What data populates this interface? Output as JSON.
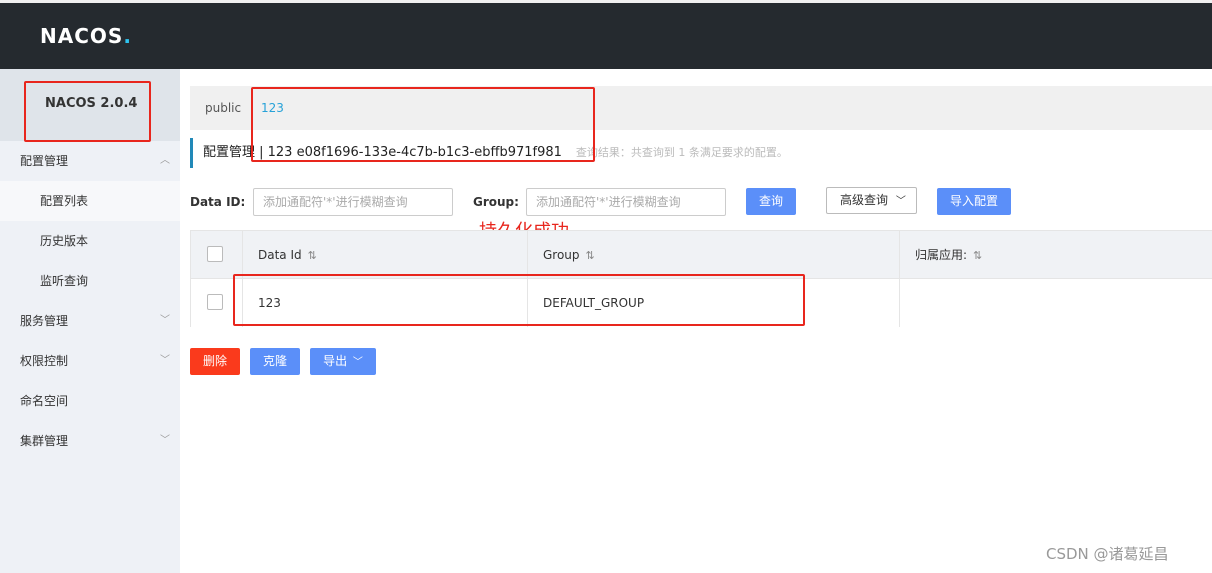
{
  "header": {
    "logo": "NACOS",
    "logo_dot": "."
  },
  "sidebar": {
    "version": "NACOS 2.0.4",
    "items": [
      {
        "label": "配置管理",
        "expanded": true
      },
      {
        "label": "配置列表"
      },
      {
        "label": "历史版本"
      },
      {
        "label": "监听查询"
      },
      {
        "label": "服务管理"
      },
      {
        "label": "权限控制"
      },
      {
        "label": "命名空间"
      },
      {
        "label": "集群管理"
      }
    ]
  },
  "namespace_tabs": [
    {
      "label": "public"
    },
    {
      "label": "123",
      "active": true
    }
  ],
  "breadcrumb": {
    "text": "配置管理 | 123 e08f1696-133e-4c7b-b1c3-ebffb971f981",
    "hint": "查询结果：共查询到 1 条满足要求的配置。"
  },
  "search": {
    "data_id_label": "Data ID:",
    "data_id_placeholder": "添加通配符'*'进行模糊查询",
    "group_label": "Group:",
    "group_placeholder": "添加通配符'*'进行模糊查询",
    "query_button": "查询",
    "advanced_button": "高级查询",
    "import_button": "导入配置"
  },
  "annotation": "持久化成功",
  "table": {
    "headers": [
      "Data Id",
      "Group",
      "归属应用:"
    ],
    "rows": [
      {
        "data_id": "123",
        "group": "DEFAULT_GROUP",
        "app": ""
      }
    ]
  },
  "actions": {
    "delete": "删除",
    "clone": "克隆",
    "export": "导出"
  },
  "watermark": "CSDN @诸葛延昌",
  "colors": {
    "accent": "#5b8ff9",
    "danger": "#fa3a1c",
    "annotation": "#e8261d",
    "topbar": "#252a2f"
  }
}
